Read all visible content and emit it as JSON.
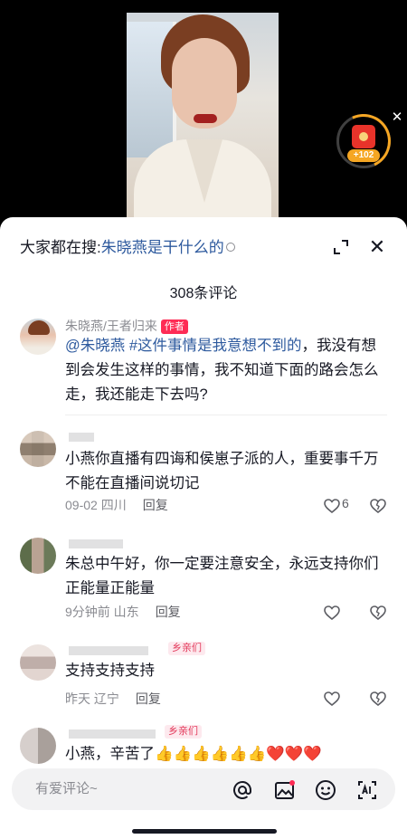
{
  "video": {
    "redpacket_badge": "+102"
  },
  "search": {
    "prefix": "大家都在搜:",
    "term": "朱晓燕是干什么的"
  },
  "comments_header": {
    "count_text": "308条评论"
  },
  "comments": [
    {
      "username": "朱晓燕/王者归来",
      "tag": "作者",
      "mention": "@朱晓燕 #这件事情是我意想不到的",
      "text": "，我没有想到会发生这样的事情，我不知道下面的路会怎么走，我还能走下去吗?"
    },
    {
      "text": "小燕你直播有四诲和侯崽子派的人，重要事千万不能在直播间说切记",
      "time_location": "09-02 四川",
      "reply": "回复",
      "likes": "6"
    },
    {
      "text": "朱总中午好，你一定要注意安全，永远支持你们正能量正能量",
      "time_location": "9分钟前 山东",
      "reply": "回复"
    },
    {
      "tag": "乡亲们",
      "text": "支持支持支持",
      "time_location": "昨天 辽宁",
      "reply": "回复"
    },
    {
      "tag": "乡亲们",
      "text": "小燕，辛苦了👍👍👍👍👍👍❤️❤️❤️"
    }
  ],
  "input": {
    "placeholder": "有爱评论~"
  },
  "colors": {
    "accent_red": "#fe2c55",
    "link_blue": "#2e5a9e",
    "gold": "#f5a623"
  }
}
